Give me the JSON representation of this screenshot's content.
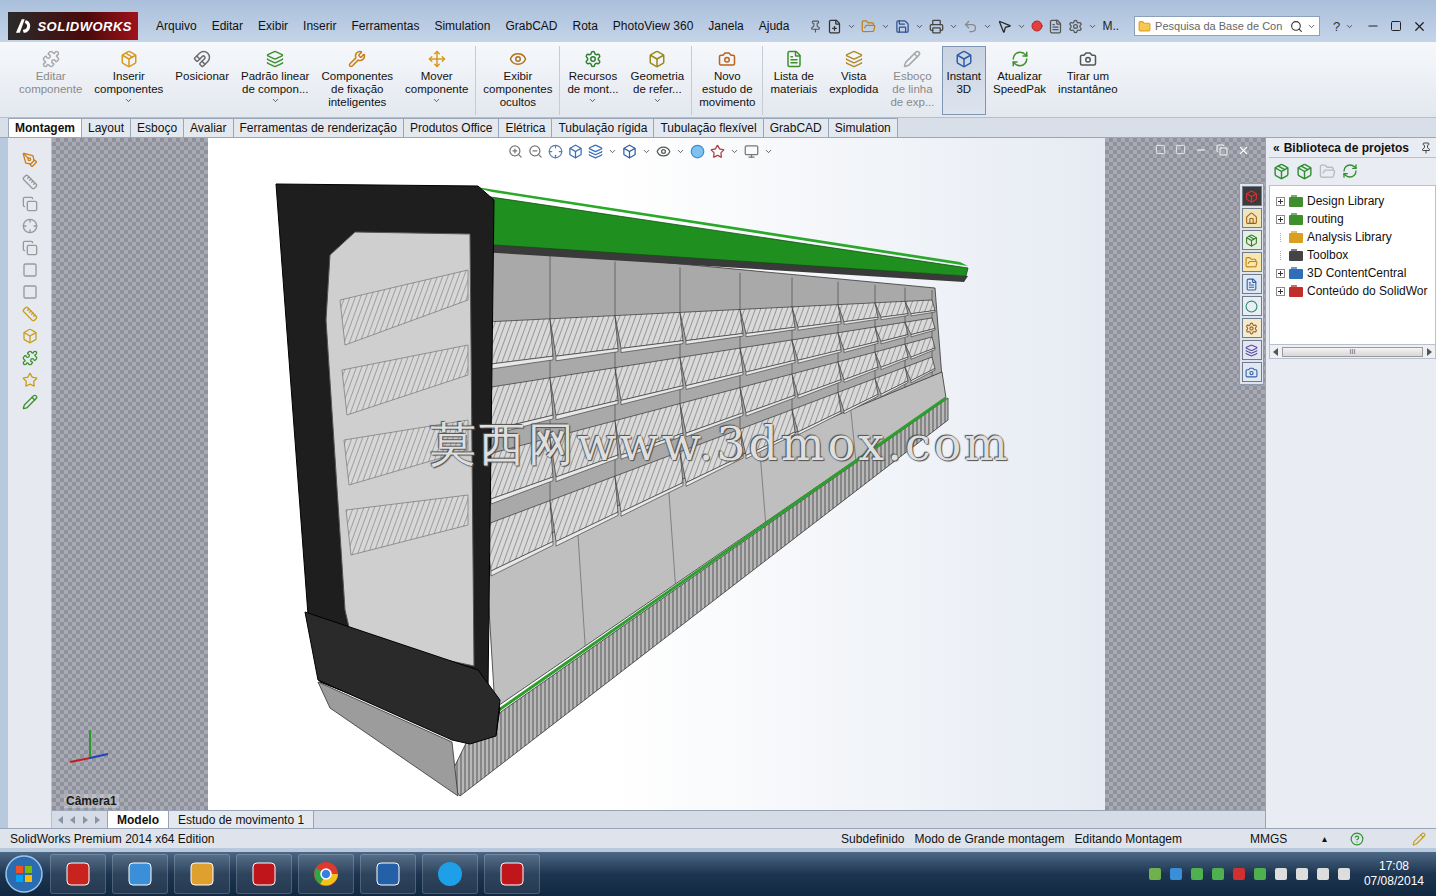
{
  "app": {
    "logo": "SOLIDWORKS"
  },
  "menu": [
    "Arquivo",
    "Editar",
    "Exibir",
    "Inserir",
    "Ferramentas",
    "Simulation",
    "GrabCAD",
    "Rota",
    "PhotoView 360",
    "Janela",
    "Ajuda"
  ],
  "quickbar": {
    "label": "M..",
    "search_placeholder": "Pesquisa da Base de Con",
    "help": "?"
  },
  "ribbon": [
    {
      "lines": [
        "Editar",
        "componente"
      ],
      "disabled": true,
      "dropdown": false,
      "selected": false,
      "group": 1
    },
    {
      "lines": [
        "Inserir",
        "componentes"
      ],
      "disabled": false,
      "dropdown": true,
      "selected": false,
      "group": 1
    },
    {
      "lines": [
        "Posicionar"
      ],
      "disabled": false,
      "dropdown": false,
      "selected": false,
      "group": 1
    },
    {
      "lines": [
        "Padrão linear",
        "de compon..."
      ],
      "disabled": false,
      "dropdown": true,
      "selected": false,
      "group": 1
    },
    {
      "lines": [
        "Componentes",
        "de fixação",
        "inteligentes"
      ],
      "disabled": false,
      "dropdown": false,
      "selected": false,
      "group": 1
    },
    {
      "lines": [
        "Mover",
        "componente"
      ],
      "disabled": false,
      "dropdown": true,
      "selected": false,
      "group": 1
    },
    {
      "lines": [
        "Exibir",
        "componentes",
        "ocultos"
      ],
      "disabled": false,
      "dropdown": false,
      "selected": false,
      "group": 2
    },
    {
      "lines": [
        "Recursos",
        "de mont..."
      ],
      "disabled": false,
      "dropdown": true,
      "selected": false,
      "group": 3
    },
    {
      "lines": [
        "Geometria",
        "de refer..."
      ],
      "disabled": false,
      "dropdown": true,
      "selected": false,
      "group": 3
    },
    {
      "lines": [
        "Novo",
        "estudo de",
        "movimento"
      ],
      "disabled": false,
      "dropdown": false,
      "selected": false,
      "group": 4
    },
    {
      "lines": [
        "Lista de",
        "materiais"
      ],
      "disabled": false,
      "dropdown": false,
      "selected": false,
      "group": 5
    },
    {
      "lines": [
        "Vista",
        "explodida"
      ],
      "disabled": false,
      "dropdown": false,
      "selected": false,
      "group": 5
    },
    {
      "lines": [
        "Esboço",
        "de linha",
        "de exp..."
      ],
      "disabled": true,
      "dropdown": false,
      "selected": false,
      "group": 5
    },
    {
      "lines": [
        "Instant",
        "3D"
      ],
      "disabled": false,
      "dropdown": false,
      "selected": true,
      "group": 5
    },
    {
      "lines": [
        "Atualizar",
        "SpeedPak"
      ],
      "disabled": false,
      "dropdown": false,
      "selected": false,
      "group": 5
    },
    {
      "lines": [
        "Tirar um",
        "instantâneo"
      ],
      "disabled": false,
      "dropdown": false,
      "selected": false,
      "group": 5
    }
  ],
  "tabs": [
    {
      "label": "Montagem",
      "selected": true
    },
    {
      "label": "Layout",
      "selected": false
    },
    {
      "label": "Esboço",
      "selected": false
    },
    {
      "label": "Avaliar",
      "selected": false
    },
    {
      "label": "Ferramentas de renderização",
      "selected": false
    },
    {
      "label": "Produtos Office",
      "selected": false
    },
    {
      "label": "Elétrica",
      "selected": false
    },
    {
      "label": "Tubulação rígida",
      "selected": false
    },
    {
      "label": "Tubulação flexível",
      "selected": false
    },
    {
      "label": "GrabCAD",
      "selected": false
    },
    {
      "label": "Simulation",
      "selected": false
    }
  ],
  "viewport": {
    "camera": "Câmera1",
    "watermark": "莫西网www.3dmox.com"
  },
  "task_pane": {
    "collapse": "«",
    "title": "Biblioteca de projetos",
    "items": [
      {
        "label": "Design Library",
        "expandable": true
      },
      {
        "label": "routing",
        "expandable": true
      },
      {
        "label": "Analysis Library",
        "expandable": false
      },
      {
        "label": "Toolbox",
        "expandable": false
      },
      {
        "label": "3D ContentCentral",
        "expandable": true
      },
      {
        "label": "Conteúdo do SolidWor",
        "expandable": true
      }
    ],
    "scroll_grip": "III"
  },
  "bottom_tabs": [
    {
      "label": "Modelo",
      "selected": true
    },
    {
      "label": "Estudo de movimento 1",
      "selected": false
    }
  ],
  "status_bar": {
    "edition": "SolidWorks Premium 2014 x64 Edition",
    "items": [
      "Subdefinido",
      "Modo de Grande montagem",
      "Editando Montagem"
    ],
    "units": "MMGS",
    "units_arrow": "▴"
  },
  "taskbar": {
    "time": "17:08",
    "date": "07/08/2014"
  }
}
